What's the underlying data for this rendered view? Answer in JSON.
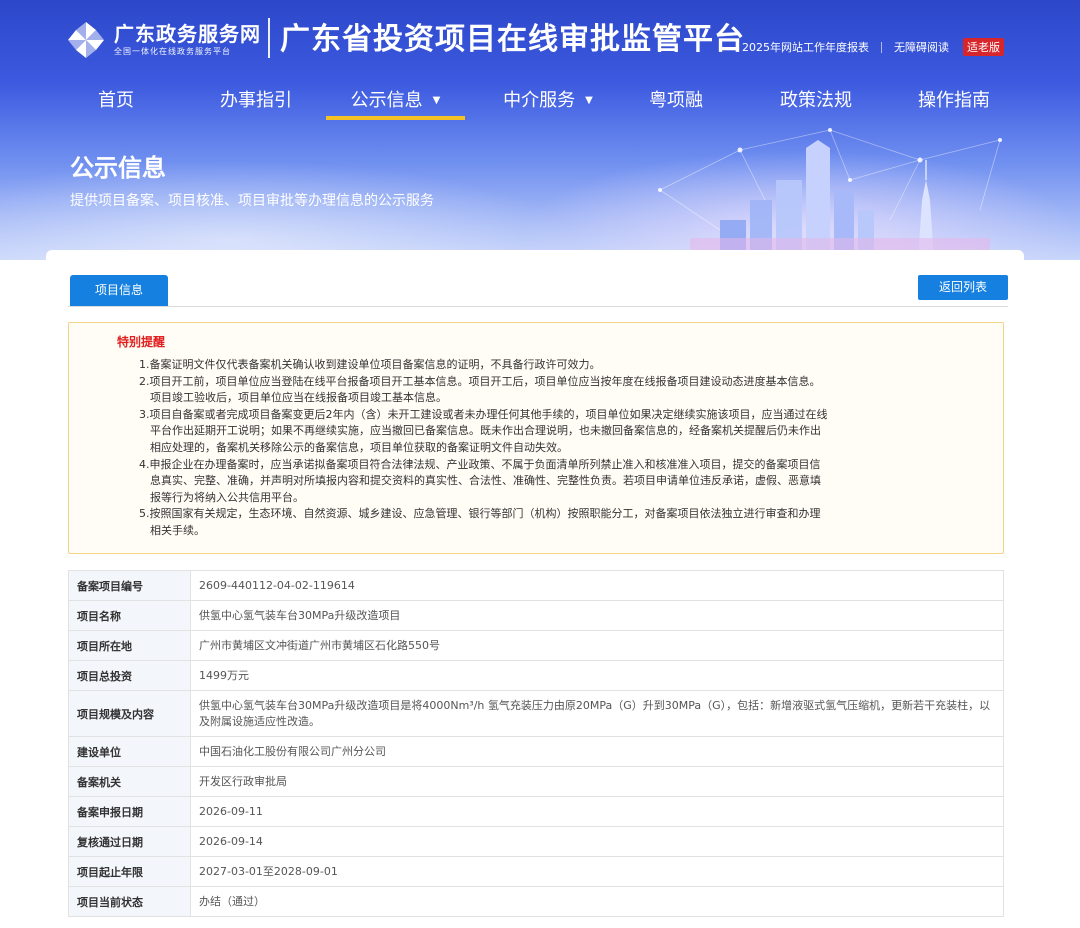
{
  "header": {
    "logo_name": "广东政务服务网",
    "logo_subtitle": "全国一体化在线政务服务平台",
    "platform_title": "广东省投资项目在线审批监管平台",
    "top_links": [
      "2025年网站工作年度报表",
      "无障碍阅读"
    ],
    "elder_mode": "适老版",
    "colors": {
      "primary": "#3d5ae0",
      "nav_active_underline": "#f4c323",
      "elder_badge": "#d6262c"
    }
  },
  "nav": {
    "items": [
      {
        "label": "首页"
      },
      {
        "label": "办事指引"
      },
      {
        "label": "公示信息",
        "active": true,
        "has_dropdown": true
      },
      {
        "label": "中介服务",
        "has_dropdown": true
      },
      {
        "label": "粤项融"
      },
      {
        "label": "政策法规"
      },
      {
        "label": "操作指南"
      }
    ],
    "dropdown_icon": "caret-down-icon"
  },
  "banner": {
    "title": "公示信息",
    "description": "提供项目备案、项目核准、项目审批等办理信息的公示服务"
  },
  "content": {
    "tab_label": "项目信息",
    "back_button": "返回列表",
    "accent_color": "#1580e0",
    "notice": {
      "title": "特别提醒",
      "items": [
        "1.备案证明文件仅代表备案机关确认收到建设单位项目备案信息的证明，不具备行政许可效力。",
        "2.项目开工前，项目单位应当登陆在线平台报备项目开工基本信息。项目开工后，项目单位应当按年度在线报备项目建设动态进度基本信息。",
        "　项目竣工验收后，项目单位应当在线报备项目竣工基本信息。",
        "3.项目自备案或者完成项目备案变更后2年内（含）未开工建设或者未办理任何其他手续的，项目单位如果决定继续实施该项目，应当通过在线",
        "　平台作出延期开工说明；如果不再继续实施，应当撤回已备案信息。既未作出合理说明，也未撤回备案信息的，经备案机关提醒后仍未作出",
        "　相应处理的，备案机关移除公示的备案信息，项目单位获取的备案证明文件自动失效。",
        "4.申报企业在办理备案时，应当承诺拟备案项目符合法律法规、产业政策、不属于负面清单所列禁止准入和核准准入项目，提交的备案项目信",
        "　息真实、完整、准确，并声明对所填报内容和提交资料的真实性、合法性、准确性、完整性负责。若项目申请单位违反承诺，虚假、恶意填",
        "　报等行为将纳入公共信用平台。",
        "5.按照国家有关规定，生态环境、自然资源、城乡建设、应急管理、银行等部门（机构）按照职能分工，对备案项目依法独立进行审查和办理",
        "　相关手续。"
      ]
    },
    "fields": [
      {
        "label": "备案项目编号",
        "value": "2609-440112-04-02-119614"
      },
      {
        "label": "项目名称",
        "value": "供氢中心氢气装车台30MPa升级改造项目"
      },
      {
        "label": "项目所在地",
        "value": "广州市黄埔区文冲街道广州市黄埔区石化路550号"
      },
      {
        "label": "项目总投资",
        "value": "1499万元"
      },
      {
        "label": "项目规模及内容",
        "value": "供氢中心氢气装车台30MPa升级改造项目是将4000Nm³/h 氢气充装压力由原20MPa（G）升到30MPa（G），包括：新增液驱式氢气压缩机，更新若干充装柱，以及附属设施适应性改造。"
      },
      {
        "label": "建设单位",
        "value": "中国石油化工股份有限公司广州分公司"
      },
      {
        "label": "备案机关",
        "value": "开发区行政审批局"
      },
      {
        "label": "备案申报日期",
        "value": "2026-09-11"
      },
      {
        "label": "复核通过日期",
        "value": "2026-09-14"
      },
      {
        "label": "项目起止年限",
        "value": "2027-03-01至2028-09-01"
      },
      {
        "label": "项目当前状态",
        "value": "办结（通过）"
      }
    ]
  }
}
